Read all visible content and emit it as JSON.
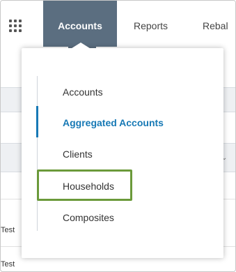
{
  "nav": {
    "tabs": [
      {
        "label": "Accounts",
        "active": true
      },
      {
        "label": "Reports",
        "active": false
      },
      {
        "label": "Rebal",
        "active": false
      }
    ]
  },
  "background": {
    "row_text_1": "Test",
    "row_text_2": "Test",
    "caret": "⌄"
  },
  "menu": {
    "items": [
      {
        "label": "Accounts"
      },
      {
        "label": "Aggregated Accounts",
        "active": true
      },
      {
        "label": "Clients"
      },
      {
        "label": "Households",
        "highlighted": true
      },
      {
        "label": "Composites"
      }
    ]
  },
  "colors": {
    "nav_active_bg": "#5b6e80",
    "menu_active": "#1779b5",
    "highlight": "#6b9a3a"
  }
}
